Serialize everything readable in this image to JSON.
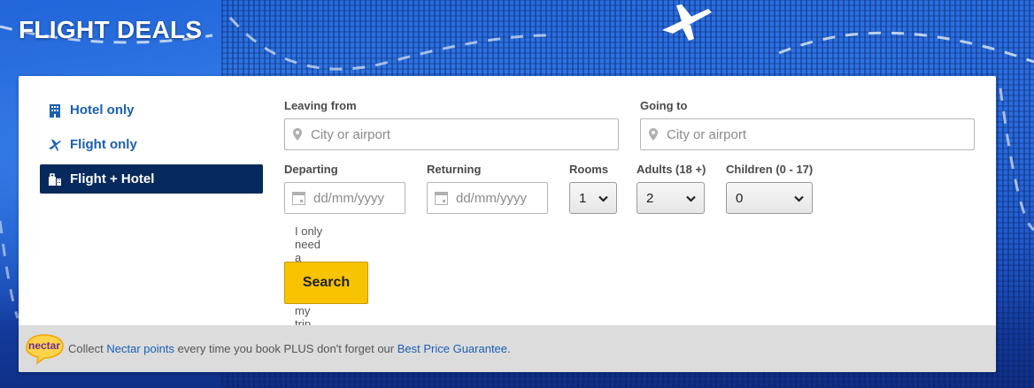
{
  "header": {
    "title": "FLIGHT DEALS"
  },
  "tabs": [
    {
      "label": "Hotel only",
      "icon": "hotel-icon"
    },
    {
      "label": "Flight only",
      "icon": "plane-icon"
    },
    {
      "label": "Flight + Hotel",
      "icon": "suitcase-icon",
      "active": true
    }
  ],
  "form": {
    "leaving_label": "Leaving from",
    "leaving_placeholder": "City or airport",
    "going_label": "Going to",
    "going_placeholder": "City or airport",
    "departing_label": "Departing",
    "departing_placeholder": "dd/mm/yyyy",
    "returning_label": "Returning",
    "returning_placeholder": "dd/mm/yyyy",
    "rooms_label": "Rooms",
    "rooms_value": "1",
    "adults_label": "Adults (18 +)",
    "adults_value": "2",
    "children_label": "Children (0 - 17)",
    "children_value": "0",
    "partial_checkbox_label": "I only need a hotel for part of my trip",
    "search_label": "Search"
  },
  "footer": {
    "badge": "nectar",
    "text_1": "Collect ",
    "link_1": "Nectar points",
    "text_2": " every time you book PLUS don't forget our ",
    "link_2": "Best Price Guarantee",
    "text_3": "."
  },
  "colors": {
    "brand_blue": "#1a5fb4",
    "active_tab": "#062a5c",
    "search_button": "#f8c300",
    "footer_bg": "#dcdcdc"
  }
}
